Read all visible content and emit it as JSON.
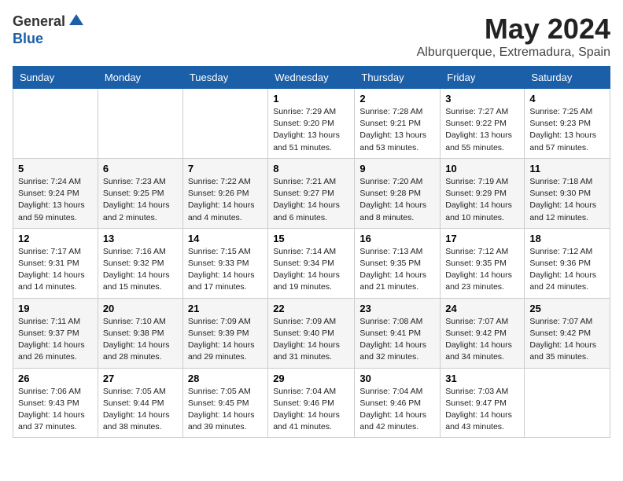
{
  "header": {
    "logo_general": "General",
    "logo_blue": "Blue",
    "month": "May 2024",
    "location": "Alburquerque, Extremadura, Spain"
  },
  "weekdays": [
    "Sunday",
    "Monday",
    "Tuesday",
    "Wednesday",
    "Thursday",
    "Friday",
    "Saturday"
  ],
  "weeks": [
    [
      {
        "day": "",
        "info": ""
      },
      {
        "day": "",
        "info": ""
      },
      {
        "day": "",
        "info": ""
      },
      {
        "day": "1",
        "info": "Sunrise: 7:29 AM\nSunset: 9:20 PM\nDaylight: 13 hours\nand 51 minutes."
      },
      {
        "day": "2",
        "info": "Sunrise: 7:28 AM\nSunset: 9:21 PM\nDaylight: 13 hours\nand 53 minutes."
      },
      {
        "day": "3",
        "info": "Sunrise: 7:27 AM\nSunset: 9:22 PM\nDaylight: 13 hours\nand 55 minutes."
      },
      {
        "day": "4",
        "info": "Sunrise: 7:25 AM\nSunset: 9:23 PM\nDaylight: 13 hours\nand 57 minutes."
      }
    ],
    [
      {
        "day": "5",
        "info": "Sunrise: 7:24 AM\nSunset: 9:24 PM\nDaylight: 13 hours\nand 59 minutes."
      },
      {
        "day": "6",
        "info": "Sunrise: 7:23 AM\nSunset: 9:25 PM\nDaylight: 14 hours\nand 2 minutes."
      },
      {
        "day": "7",
        "info": "Sunrise: 7:22 AM\nSunset: 9:26 PM\nDaylight: 14 hours\nand 4 minutes."
      },
      {
        "day": "8",
        "info": "Sunrise: 7:21 AM\nSunset: 9:27 PM\nDaylight: 14 hours\nand 6 minutes."
      },
      {
        "day": "9",
        "info": "Sunrise: 7:20 AM\nSunset: 9:28 PM\nDaylight: 14 hours\nand 8 minutes."
      },
      {
        "day": "10",
        "info": "Sunrise: 7:19 AM\nSunset: 9:29 PM\nDaylight: 14 hours\nand 10 minutes."
      },
      {
        "day": "11",
        "info": "Sunrise: 7:18 AM\nSunset: 9:30 PM\nDaylight: 14 hours\nand 12 minutes."
      }
    ],
    [
      {
        "day": "12",
        "info": "Sunrise: 7:17 AM\nSunset: 9:31 PM\nDaylight: 14 hours\nand 14 minutes."
      },
      {
        "day": "13",
        "info": "Sunrise: 7:16 AM\nSunset: 9:32 PM\nDaylight: 14 hours\nand 15 minutes."
      },
      {
        "day": "14",
        "info": "Sunrise: 7:15 AM\nSunset: 9:33 PM\nDaylight: 14 hours\nand 17 minutes."
      },
      {
        "day": "15",
        "info": "Sunrise: 7:14 AM\nSunset: 9:34 PM\nDaylight: 14 hours\nand 19 minutes."
      },
      {
        "day": "16",
        "info": "Sunrise: 7:13 AM\nSunset: 9:35 PM\nDaylight: 14 hours\nand 21 minutes."
      },
      {
        "day": "17",
        "info": "Sunrise: 7:12 AM\nSunset: 9:35 PM\nDaylight: 14 hours\nand 23 minutes."
      },
      {
        "day": "18",
        "info": "Sunrise: 7:12 AM\nSunset: 9:36 PM\nDaylight: 14 hours\nand 24 minutes."
      }
    ],
    [
      {
        "day": "19",
        "info": "Sunrise: 7:11 AM\nSunset: 9:37 PM\nDaylight: 14 hours\nand 26 minutes."
      },
      {
        "day": "20",
        "info": "Sunrise: 7:10 AM\nSunset: 9:38 PM\nDaylight: 14 hours\nand 28 minutes."
      },
      {
        "day": "21",
        "info": "Sunrise: 7:09 AM\nSunset: 9:39 PM\nDaylight: 14 hours\nand 29 minutes."
      },
      {
        "day": "22",
        "info": "Sunrise: 7:09 AM\nSunset: 9:40 PM\nDaylight: 14 hours\nand 31 minutes."
      },
      {
        "day": "23",
        "info": "Sunrise: 7:08 AM\nSunset: 9:41 PM\nDaylight: 14 hours\nand 32 minutes."
      },
      {
        "day": "24",
        "info": "Sunrise: 7:07 AM\nSunset: 9:42 PM\nDaylight: 14 hours\nand 34 minutes."
      },
      {
        "day": "25",
        "info": "Sunrise: 7:07 AM\nSunset: 9:42 PM\nDaylight: 14 hours\nand 35 minutes."
      }
    ],
    [
      {
        "day": "26",
        "info": "Sunrise: 7:06 AM\nSunset: 9:43 PM\nDaylight: 14 hours\nand 37 minutes."
      },
      {
        "day": "27",
        "info": "Sunrise: 7:05 AM\nSunset: 9:44 PM\nDaylight: 14 hours\nand 38 minutes."
      },
      {
        "day": "28",
        "info": "Sunrise: 7:05 AM\nSunset: 9:45 PM\nDaylight: 14 hours\nand 39 minutes."
      },
      {
        "day": "29",
        "info": "Sunrise: 7:04 AM\nSunset: 9:46 PM\nDaylight: 14 hours\nand 41 minutes."
      },
      {
        "day": "30",
        "info": "Sunrise: 7:04 AM\nSunset: 9:46 PM\nDaylight: 14 hours\nand 42 minutes."
      },
      {
        "day": "31",
        "info": "Sunrise: 7:03 AM\nSunset: 9:47 PM\nDaylight: 14 hours\nand 43 minutes."
      },
      {
        "day": "",
        "info": ""
      }
    ]
  ]
}
